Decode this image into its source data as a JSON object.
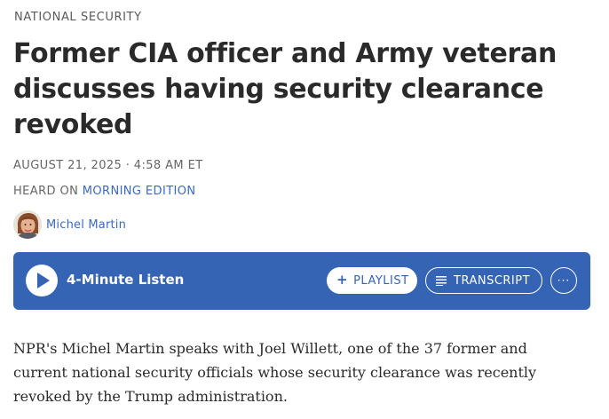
{
  "section": "NATIONAL SECURITY",
  "headline": "Former CIA officer and Army veteran discusses having security clearance revoked",
  "dateline": "AUGUST 21, 2025 · 4:58 AM ET",
  "heard_on": {
    "prefix": "HEARD ON",
    "program": "MORNING EDITION"
  },
  "byline": {
    "author": "Michel Martin"
  },
  "player": {
    "listen_label": "4-Minute Listen",
    "playlist_label": "PLAYLIST",
    "transcript_label": "TRANSCRIPT",
    "more_label": "···"
  },
  "body": "NPR's Michel Martin speaks with Joel Willett, one of the 37 former and current national security officials whose security clearance was recently revoked by the Trump administration.",
  "colors": {
    "accent": "#3664b4",
    "link": "#3c6abf",
    "text": "#2a2a2a"
  }
}
